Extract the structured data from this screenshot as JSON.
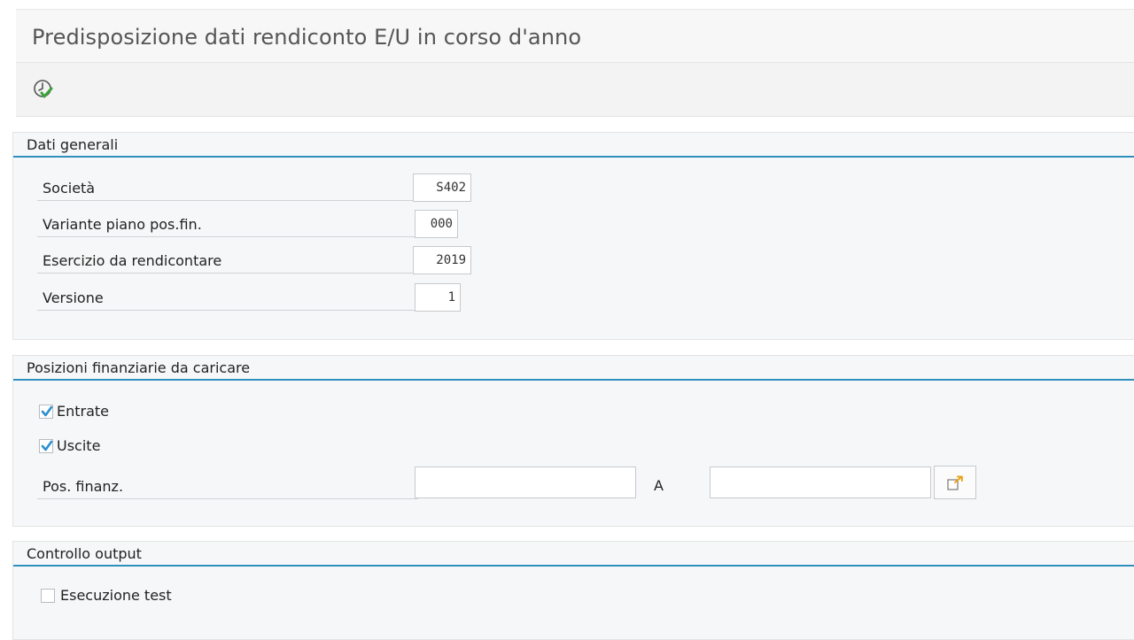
{
  "window": {
    "title": "Predisposizione dati rendiconto E/U in corso d'anno"
  },
  "toolbar": {
    "execute_icon": "execute-clock-check-icon"
  },
  "sections": {
    "general": {
      "title": "Dati generali",
      "fields": [
        {
          "label": "Società",
          "value": "S402"
        },
        {
          "label": "Variante piano pos.fin.",
          "value": "000"
        },
        {
          "label": "Esercizio da rendicontare",
          "value": "2019"
        },
        {
          "label": "Versione",
          "value": "1"
        }
      ]
    },
    "positions": {
      "title": "Posizioni finanziarie da caricare",
      "checkboxes": [
        {
          "label": "Entrate",
          "checked": true
        },
        {
          "label": "Uscite",
          "checked": true
        }
      ],
      "range": {
        "label": "Pos. finanz.",
        "from_value": "",
        "to_label": "A",
        "to_value": "",
        "multi_select_icon": "multiple-selection-arrow-icon"
      }
    },
    "output": {
      "title": "Controllo output",
      "checkboxes": [
        {
          "label": "Esecuzione test",
          "checked": false
        }
      ]
    }
  },
  "colors": {
    "accent": "#2f8fbd",
    "check": "#2a8fd0",
    "execute_green": "#3aa33a"
  }
}
